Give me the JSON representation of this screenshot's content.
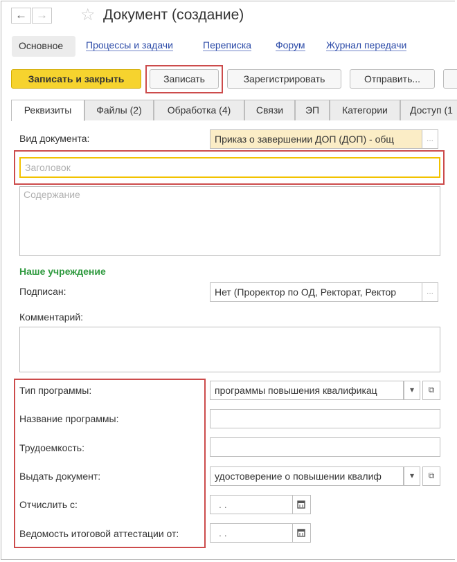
{
  "window": {
    "back_icon": "←",
    "forward_icon": "→",
    "star_icon": "☆",
    "title": "Документ (создание)"
  },
  "linkbar": {
    "selected": "Основное",
    "links": [
      "Процессы и задачи",
      "Переписка",
      "Форум",
      "Журнал передачи"
    ]
  },
  "toolbar": {
    "save_close": "Записать и закрыть",
    "save": "Записать",
    "register": "Зарегистрировать",
    "send": "Отправить..."
  },
  "tabs": [
    "Реквизиты",
    "Файлы (2)",
    "Обработка (4)",
    "Связи",
    "ЭП",
    "Категории",
    "Доступ (1"
  ],
  "form": {
    "doc_type_label": "Вид документа:",
    "doc_type_value": "Приказ о завершении ДОП (ДОП) - общ",
    "ellipsis": "...",
    "title_placeholder": "Заголовок",
    "content_placeholder": "Содержание",
    "section_title": "Наше учреждение",
    "signed_label": "Подписан:",
    "signed_value": "Нет (Проректор по ОД, Ректорат, Ректор",
    "comment_label": "Комментарий:",
    "program_type_label": "Тип программы:",
    "program_type_value": "программы повышения квалификац",
    "program_name_label": "Название программы:",
    "program_name_value": "",
    "labor_label": "Трудоемкость:",
    "labor_value": "",
    "issue_doc_label": "Выдать документ:",
    "issue_doc_value": "удостоверение о повышении квалиф",
    "expel_label": "Отчислить с:",
    "expel_value": ". .",
    "attestation_label": "Ведомость итоговой аттестации от:",
    "attestation_value": ". .",
    "dropdown_icon": "▾",
    "open_icon": "⧉"
  },
  "colors": {
    "primary_button": "#f6d32e",
    "highlight_frame": "#cc4b4b",
    "section_green": "#2f9a3f",
    "link_blue": "#2c4ba8",
    "field_yellow": "#fbedc6"
  }
}
